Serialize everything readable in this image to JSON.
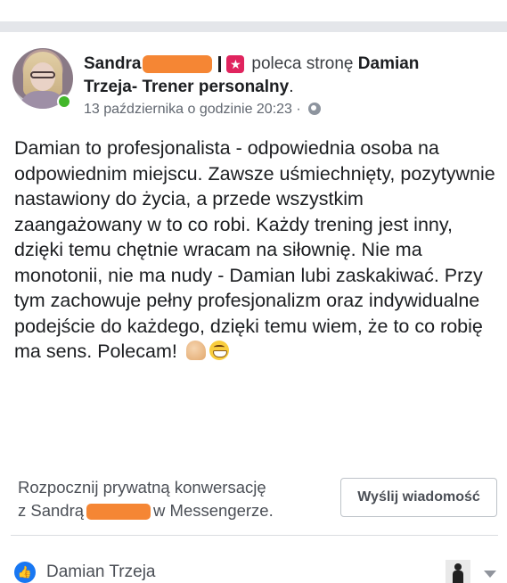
{
  "post": {
    "author_name": "Sandra",
    "recommends_text": "poleca stronę",
    "page_name_part1": "Damian",
    "page_name_part2": "Trzeja- Trener personalny",
    "page_name_dot": ".",
    "timestamp": "13 października o godzinie 20:23",
    "timestamp_sep": "·",
    "body_text": "Damian to profesjonalista - odpowiednia osoba na odpowiednim miejscu. Zawsze uśmiechnięty, pozytywnie nastawiony do życia, a przede wszystkim zaangażowany w to co robi. Każdy trening jest inny, dzięki temu chętnie wracam na siłownię. Nie ma monotonii, nie ma nudy - Damian lubi zaskakiwać. Przy tym zachowuje pełny profesjonalizm oraz indywidualne podejście do każdego, dzięki temu wiem, że to co robię ma sens. Polecam!",
    "icons": {
      "recommend": "recommend-star-icon",
      "privacy": "globe-icon",
      "emoji1": "flexed-biceps-emoji",
      "emoji2": "grinning-emoji"
    },
    "colors": {
      "redaction": "#f58634",
      "online": "#42b72a"
    }
  },
  "messenger": {
    "line1": "Rozpocznij prywatną konwersację",
    "line2_prefix": "z Sandrą",
    "line2_suffix": "w Messengerze.",
    "button_label": "Wyślij wiadomość"
  },
  "footer": {
    "responder_name": "Damian Trzeja",
    "like_icon": "like-thumb-icon",
    "menu_icon": "caret-down-icon"
  }
}
